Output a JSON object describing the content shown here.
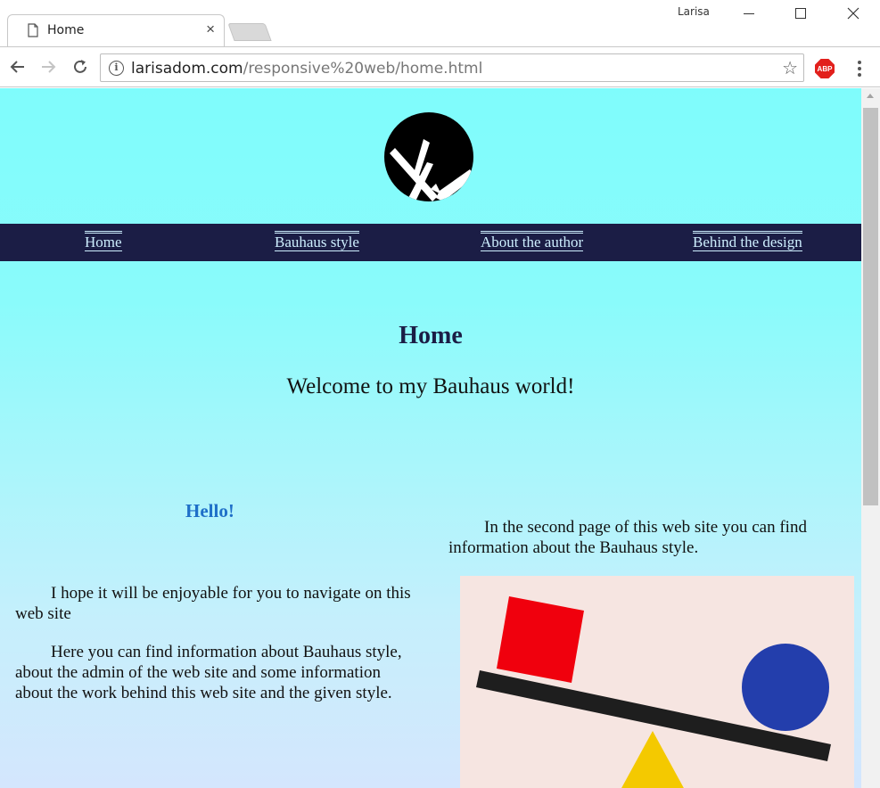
{
  "browser": {
    "tab_title": "Home",
    "tab_close": "×",
    "profile_name": "Larisa",
    "url_host": "larisadom.com",
    "url_path": "/responsive%20web/home.html",
    "star_glyph": "☆",
    "info_glyph": "i",
    "extension_label": "ABP"
  },
  "site": {
    "nav": {
      "items": [
        {
          "label": "Home"
        },
        {
          "label": "Bauhaus style"
        },
        {
          "label": "About the author"
        },
        {
          "label": "Behind the design"
        }
      ]
    },
    "title": "Home",
    "welcome": "Welcome to my Bauhaus world!",
    "hello": "Hello!",
    "paragraphs": [
      "I hope it will be enjoyable for you to navigate on this web site",
      "Here you can find information about Bauhaus style, about the admin of the web site and some information about the work behind this web site and the given style.",
      "In the second page of this web site you can find information about the Bauhaus style."
    ]
  },
  "colors": {
    "nav_bg": "#1b1d45",
    "hello_blue": "#1e6fc8",
    "art_red": "#f0000d",
    "art_blue": "#233eac",
    "art_yellow": "#f4c900",
    "art_bg": "#f6e5e1"
  }
}
